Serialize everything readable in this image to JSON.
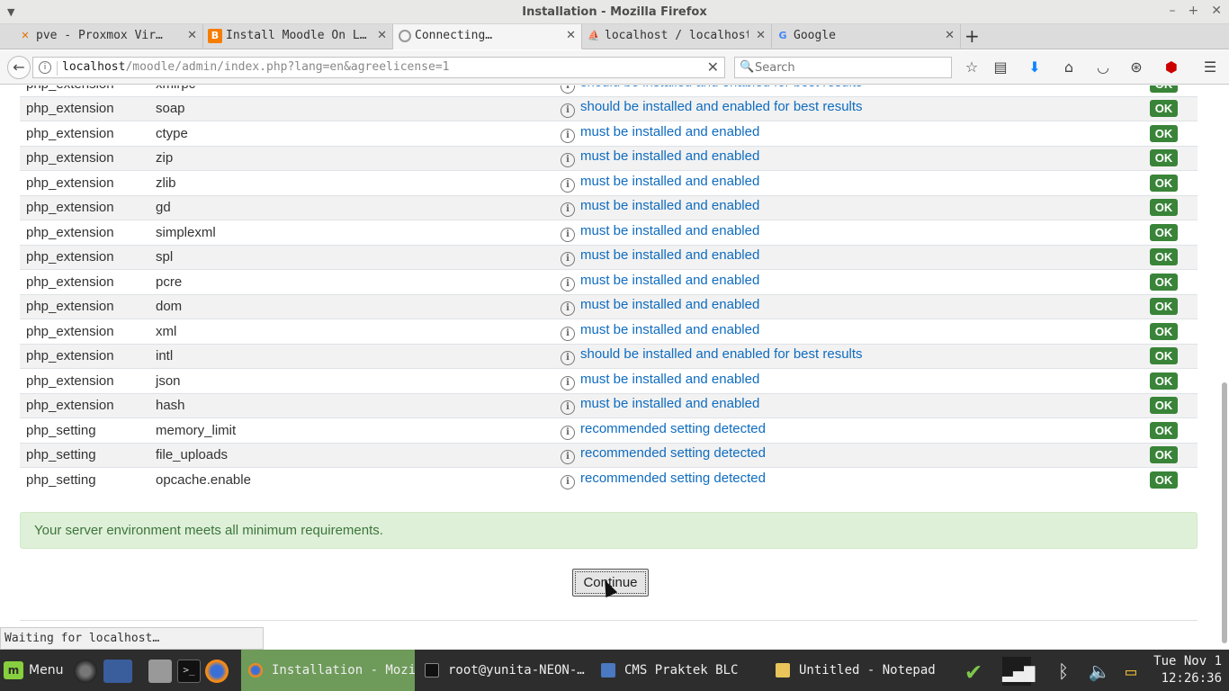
{
  "window": {
    "title": "Installation - Mozilla Firefox"
  },
  "tabs": [
    {
      "label": "pve - Proxmox Vir…",
      "icon": "proxmox-icon"
    },
    {
      "label": "Install Moodle On L…",
      "icon": "blogger-icon"
    },
    {
      "label": "Connecting…",
      "icon": "loading-icon",
      "active": true
    },
    {
      "label": "localhost / localhost…",
      "icon": "phpmyadmin-icon"
    },
    {
      "label": "Google",
      "icon": "google-icon"
    }
  ],
  "nav": {
    "url_prefix": "localhost",
    "url_path": "/moodle/admin/index.php?lang=en&agreelicense=1",
    "search_placeholder": "Search"
  },
  "environment": {
    "rows": [
      {
        "name": "php_extension",
        "info": "xmlrpc",
        "report": "should be installed and enabled for best results",
        "status": "OK"
      },
      {
        "name": "php_extension",
        "info": "soap",
        "report": "should be installed and enabled for best results",
        "status": "OK"
      },
      {
        "name": "php_extension",
        "info": "ctype",
        "report": "must be installed and enabled",
        "status": "OK"
      },
      {
        "name": "php_extension",
        "info": "zip",
        "report": "must be installed and enabled",
        "status": "OK"
      },
      {
        "name": "php_extension",
        "info": "zlib",
        "report": "must be installed and enabled",
        "status": "OK"
      },
      {
        "name": "php_extension",
        "info": "gd",
        "report": "must be installed and enabled",
        "status": "OK"
      },
      {
        "name": "php_extension",
        "info": "simplexml",
        "report": "must be installed and enabled",
        "status": "OK"
      },
      {
        "name": "php_extension",
        "info": "spl",
        "report": "must be installed and enabled",
        "status": "OK"
      },
      {
        "name": "php_extension",
        "info": "pcre",
        "report": "must be installed and enabled",
        "status": "OK"
      },
      {
        "name": "php_extension",
        "info": "dom",
        "report": "must be installed and enabled",
        "status": "OK"
      },
      {
        "name": "php_extension",
        "info": "xml",
        "report": "must be installed and enabled",
        "status": "OK"
      },
      {
        "name": "php_extension",
        "info": "intl",
        "report": "should be installed and enabled for best results",
        "status": "OK"
      },
      {
        "name": "php_extension",
        "info": "json",
        "report": "must be installed and enabled",
        "status": "OK"
      },
      {
        "name": "php_extension",
        "info": "hash",
        "report": "must be installed and enabled",
        "status": "OK"
      },
      {
        "name": "php_setting",
        "info": "memory_limit",
        "report": "recommended setting detected",
        "status": "OK"
      },
      {
        "name": "php_setting",
        "info": "file_uploads",
        "report": "recommended setting detected",
        "status": "OK"
      },
      {
        "name": "php_setting",
        "info": "opcache.enable",
        "report": "recommended setting detected",
        "status": "OK"
      }
    ],
    "success_message": "Your server environment meets all minimum requirements.",
    "continue_label": "Continue"
  },
  "status_text": "Waiting for localhost…",
  "taskbar": {
    "menu_label": "Menu",
    "tasks": [
      {
        "label": "Installation - Mozill…",
        "active": true
      },
      {
        "label": "root@yunita-NEON-…",
        "active": false
      },
      {
        "label": "CMS Praktek BLC",
        "active": false
      },
      {
        "label": "Untitled - Notepad",
        "active": false
      }
    ],
    "clock_day": "Tue Nov  1",
    "clock_time": "12:26:36"
  },
  "colors": {
    "ok_badge": "#398439",
    "link_blue": "#0f6cbf",
    "success_bg": "#dff0d8",
    "taskbar_active": "#6e9b5a"
  }
}
